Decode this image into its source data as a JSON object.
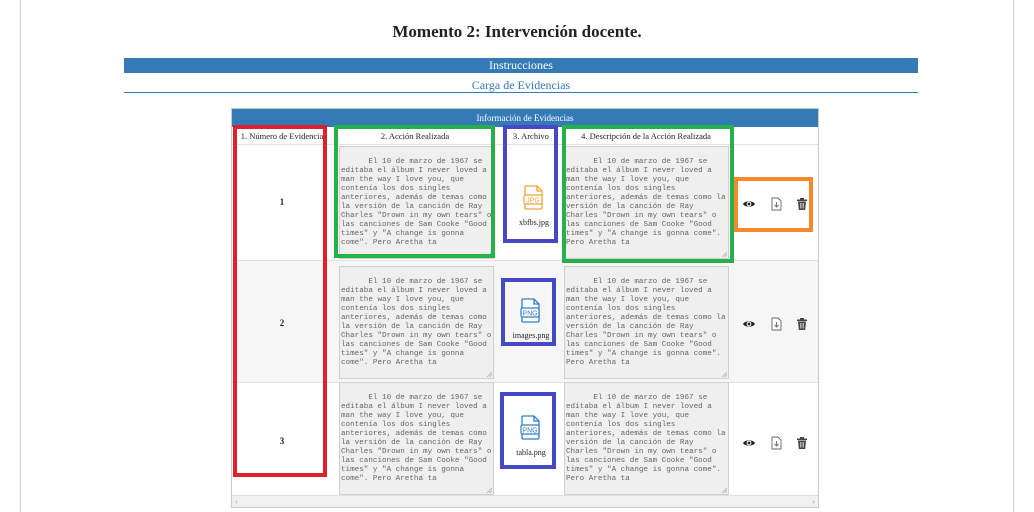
{
  "page_title": "Momento 2: Intervención docente.",
  "instructions_bar": "Instrucciones",
  "upload_bar": "Carga de Evidencias",
  "panel": {
    "title": "Información de Evidencias",
    "columns": [
      "1. Número de Evidencia",
      "2. Acción Realizada",
      "3. Archivo",
      "4. Descripción de la Acción Realizada"
    ]
  },
  "rows": [
    {
      "number": "1",
      "action_text": "El 10 de marzo de 1967 se editaba el álbum I never loved a man the way I love you, que contenía los dos singles anteriores, además de temas como la versión de la canción de Ray Charles \"Drown in my own tears\" o las canciones de Sam Cooke \"Good times\" y \"A change is gonna come\". Pero Aretha ta",
      "file_type": "JPG",
      "file_name": "xbfbs.jpg",
      "description_text": "El 10 de marzo de 1967 se editaba el álbum I never loved a man the way I love you, que contenía los dos singles anteriores, además de temas como la versión de la canción de Ray Charles \"Drown in my own tears\" o las canciones de Sam Cooke \"Good times\" y \"A change is gonna come\". Pero Aretha ta"
    },
    {
      "number": "2",
      "action_text": "El 10 de marzo de 1967 se editaba el álbum I never loved a man the way I love you, que contenía los dos singles anteriores, además de temas como la versión de la canción de Ray Charles \"Drown in my own tears\" o las canciones de Sam Cooke \"Good times\" y \"A change is gonna come\". Pero Aretha ta",
      "file_type": "PNG",
      "file_name": "images.png",
      "description_text": "El 10 de marzo de 1967 se editaba el álbum I never loved a man the way I love you, que contenía los dos singles anteriores, además de temas como la versión de la canción de Ray Charles \"Drown in my own tears\" o las canciones de Sam Cooke \"Good times\" y \"A change is gonna come\". Pero Aretha ta"
    },
    {
      "number": "3",
      "action_text": "El 10 de marzo de 1967 se editaba el álbum I never loved a man the way I love you, que contenía los dos singles anteriores, además de temas como la versión de la canción de Ray Charles \"Drown in my own tears\" o las canciones de Sam Cooke \"Good times\" y \"A change is gonna come\". Pero Aretha ta",
      "file_type": "PNG",
      "file_name": "tabla.png",
      "description_text": "El 10 de marzo de 1967 se editaba el álbum I never loved a man the way I love you, que contenía los dos singles anteriores, además de temas como la versión de la canción de Ray Charles \"Drown in my own tears\" o las canciones de Sam Cooke \"Good times\" y \"A change is gonna come\". Pero Aretha ta"
    }
  ],
  "actions": {
    "icons": [
      "eye-icon",
      "download-icon",
      "trash-icon"
    ]
  },
  "colors": {
    "primary": "#337ab7",
    "highlight_red": "#e0202a",
    "highlight_green": "#25b04a",
    "highlight_blue": "#4748c7",
    "highlight_orange": "#f5892b",
    "jpg_icon": "#f0a43a",
    "png_icon": "#2f7fc2"
  }
}
